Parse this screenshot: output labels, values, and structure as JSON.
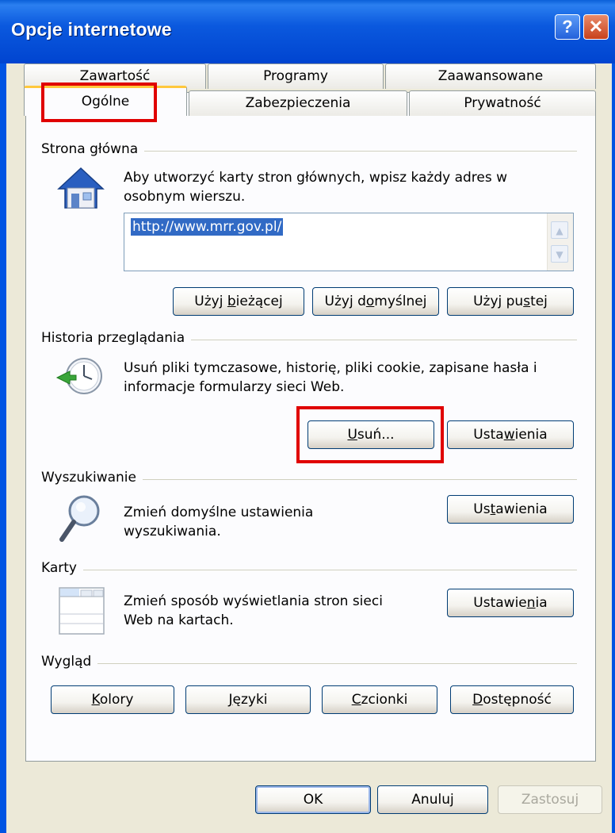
{
  "window": {
    "title": "Opcje internetowe",
    "help_label": "?",
    "close_label": "✕",
    "colors": {
      "titlebar": "#0054e3",
      "highlight": "#e00000",
      "dialog_bg": "#ece9d8"
    }
  },
  "tabs": {
    "row_back": [
      "Zawartość",
      "Programy",
      "Zaawansowane"
    ],
    "row_front": [
      "Ogólne",
      "Zabezpieczenia",
      "Prywatność"
    ],
    "active": "Ogólne"
  },
  "home": {
    "label": "Strona główna",
    "icon": "house-icon",
    "desc": [
      "Aby utworzyć karty stron głównych, wpisz każdy adres w",
      "osobnym wierszu."
    ],
    "url": "http://www.mrr.gov.pl/",
    "buttons": {
      "current": {
        "a": "Użyj ",
        "u": "b",
        "b": "ieżącej"
      },
      "default": {
        "a": "Użyj d",
        "u": "o",
        "b": "myślnej"
      },
      "blank": {
        "a": "Użyj pu",
        "u": "s",
        "b": "tej"
      }
    }
  },
  "history": {
    "label": "Historia przeglądania",
    "icon": "history-clock-icon",
    "desc": [
      "Usuń pliki tymczasowe, historię, pliki cookie, zapisane hasła i",
      "informacje formularzy sieci Web."
    ],
    "delete_button": {
      "a": "",
      "u": "U",
      "b": "suń..."
    },
    "settings_button": {
      "a": "Usta",
      "u": "w",
      "b": "ienia"
    }
  },
  "search": {
    "label": "Wyszukiwanie",
    "icon": "magnifier-icon",
    "desc": [
      "Zmień domyślne ustawienia",
      "wyszukiwania."
    ],
    "settings_button": {
      "a": "Us",
      "u": "t",
      "b": "awienia"
    }
  },
  "tabs_section": {
    "label": "Karty",
    "icon": "tabs-window-icon",
    "desc": [
      "Zmień sposób wyświetlania stron sieci",
      "Web na kartach."
    ],
    "settings_button": {
      "a": "Ustawie",
      "u": "n",
      "b": "ia"
    }
  },
  "appearance": {
    "label": "Wygląd",
    "colors_button": {
      "a": "",
      "u": "K",
      "b": "olory"
    },
    "languages_button": {
      "a": "",
      "u": "J",
      "b": "ęzyki"
    },
    "fonts_button": {
      "a": "",
      "u": "C",
      "b": "zcionki"
    },
    "accessibility_button": {
      "a": "",
      "u": "D",
      "b": "ostępność"
    }
  },
  "footer": {
    "ok": "OK",
    "cancel": "Anuluj",
    "apply": "Zastosuj"
  }
}
